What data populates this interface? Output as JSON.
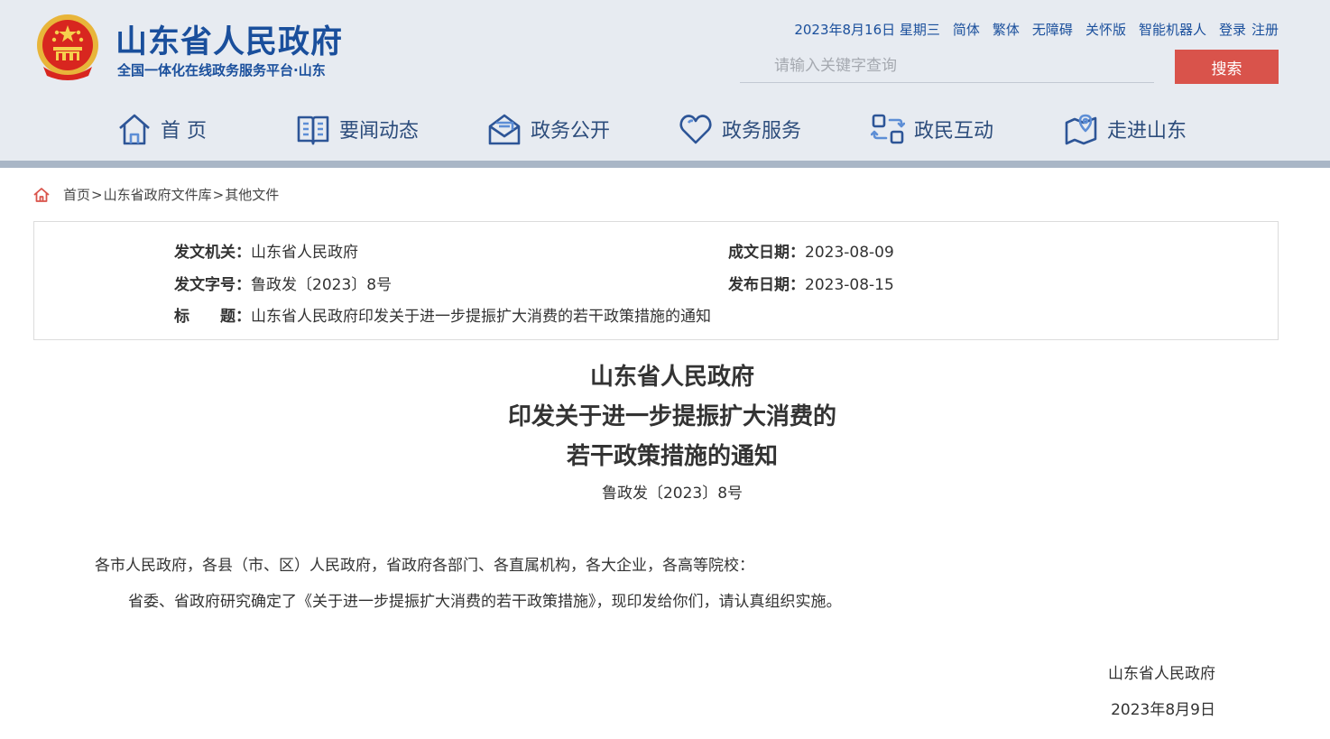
{
  "header": {
    "site_title": "山东省人民政府",
    "site_subtitle": "全国一体化在线政务服务平台·山东",
    "date": "2023年8月16日 星期三",
    "links": [
      "简体",
      "繁体",
      "无障碍",
      "关怀版",
      "智能机器人",
      "登录",
      "注册"
    ],
    "search": {
      "placeholder": "请输入关键字查询",
      "button": "搜索"
    },
    "nav": [
      {
        "label": "首 页",
        "icon": "home-icon"
      },
      {
        "label": "要闻动态",
        "icon": "news-icon"
      },
      {
        "label": "政务公开",
        "icon": "mail-open-icon"
      },
      {
        "label": "政务服务",
        "icon": "heart-icon"
      },
      {
        "label": "政民互动",
        "icon": "interaction-icon"
      },
      {
        "label": "走进山东",
        "icon": "location-icon"
      }
    ],
    "colors": {
      "brand": "#1a4f9c",
      "search_button": "#d9534b",
      "header_bg": "#e7ebf1"
    }
  },
  "breadcrumb": {
    "items": [
      "首页",
      "山东省政府文件库",
      "其他文件"
    ],
    "separator": ">"
  },
  "info": {
    "issuer_label": "发文机关：",
    "issuer": "山东省人民政府",
    "created_label": "成文日期：",
    "created": "2023-08-09",
    "doc_no_label": "发文字号：",
    "doc_no": "鲁政发〔2023〕8号",
    "published_label": "发布日期：",
    "published": "2023-08-15",
    "title_label_a": "标",
    "title_label_b": "题：",
    "title": "山东省人民政府印发关于进一步提振扩大消费的若干政策措施的通知"
  },
  "document": {
    "title_lines": [
      "山东省人民政府",
      "印发关于进一步提振扩大消费的",
      "若干政策措施的通知"
    ],
    "number": "鲁政发〔2023〕8号",
    "salutation": "各市人民政府，各县（市、区）人民政府，省政府各部门、各直属机构，各大企业，各高等院校：",
    "body": "省委、省政府研究确定了《关于进一步提振扩大消费的若干政策措施》，现印发给你们，请认真组织实施。",
    "signature": "山东省人民政府",
    "sign_date": "2023年8月9日"
  }
}
